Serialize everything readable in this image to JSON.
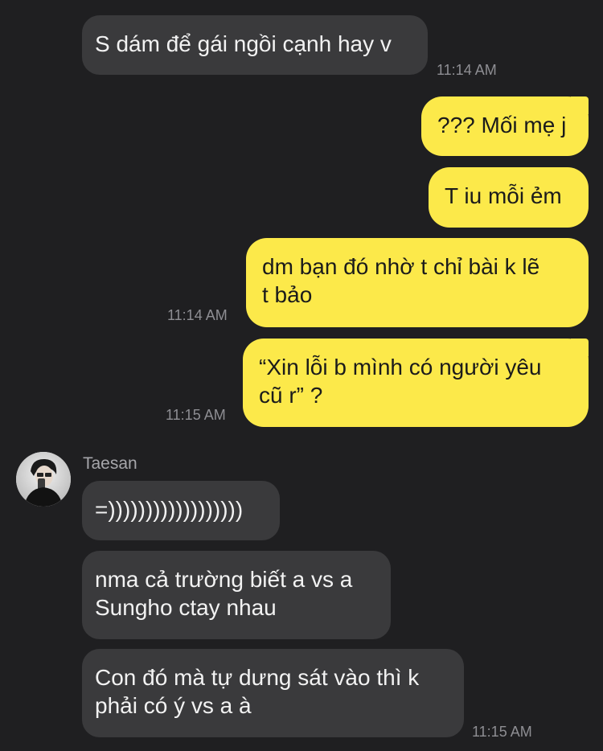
{
  "conversation": {
    "sender_name": "Taesan",
    "messages": [
      {
        "direction": "incoming",
        "text": "S dám để gái ngồi cạnh hay v",
        "time": "11:14 AM"
      },
      {
        "direction": "outgoing",
        "text": "??? Mối mẹ j",
        "time": ""
      },
      {
        "direction": "outgoing",
        "text": "T iu mỗi ẻm",
        "time": ""
      },
      {
        "direction": "outgoing",
        "text": "dm bạn đó nhờ t chỉ bài k lẽ\nt bảo",
        "time": "11:14 AM"
      },
      {
        "direction": "outgoing",
        "text": "“Xin lỗi b mình có người yêu\ncũ r” ?",
        "time": "11:15 AM"
      },
      {
        "direction": "incoming",
        "text": "=))))))))))))))))))",
        "time": ""
      },
      {
        "direction": "incoming",
        "text": "nma cả trường biết a vs a\nSungho ctay nhau",
        "time": ""
      },
      {
        "direction": "incoming",
        "text": "Con đó mà tự dưng sát vào thì k\nphải có ý vs a à",
        "time": "11:15 AM"
      }
    ]
  },
  "colors": {
    "background": "#1f1f21",
    "incoming_bubble": "#3a3a3c",
    "outgoing_bubble": "#fce94a",
    "timestamp": "#8e8e93"
  },
  "icons": {
    "avatar": "profile-photo"
  }
}
